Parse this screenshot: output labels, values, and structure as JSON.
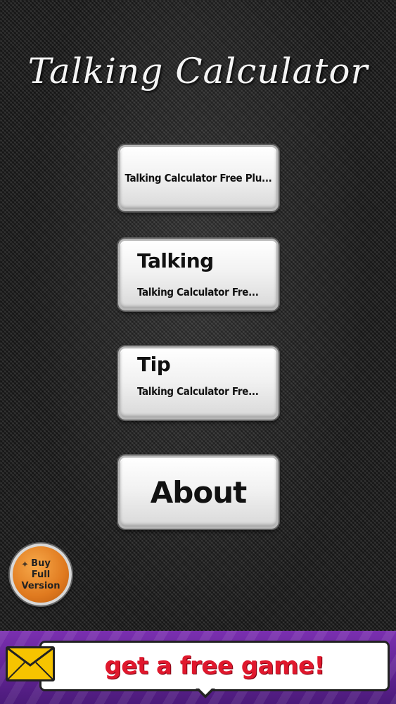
{
  "app": {
    "title": "Talking Calculator"
  },
  "menu": {
    "button1": {
      "label": "Talking Calculator Free Plu..."
    },
    "button2": {
      "title": "Talking",
      "subtitle": "Talking Calculator Fre..."
    },
    "button3": {
      "title": "Tip",
      "subtitle": "Talking Calculator Fre..."
    },
    "button4": {
      "label": "About"
    }
  },
  "buy_badge": {
    "line1": "Buy",
    "line2": "Full",
    "line3": "Version"
  },
  "ad": {
    "text": "get a free game!",
    "icon": "envelope-icon"
  },
  "colors": {
    "ad_text": "#e0182d",
    "ad_bg": "#7a2fb0",
    "badge": "#e07a1f",
    "envelope": "#f6c400"
  }
}
